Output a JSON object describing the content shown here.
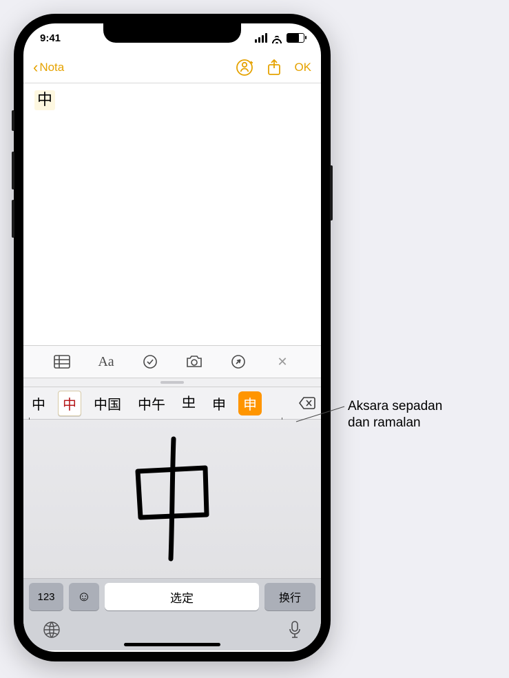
{
  "status": {
    "time": "9:41"
  },
  "nav": {
    "back_label": "Nota",
    "ok_label": "OK"
  },
  "note": {
    "text": "中"
  },
  "candidates": {
    "items": [
      "中",
      "中",
      "中国",
      "中午",
      "𠀐",
      "申",
      "申"
    ],
    "tile_index": 1,
    "highlight_index": 6
  },
  "keyboard": {
    "num_label": "123",
    "space_label": "选定",
    "return_label": "换行"
  },
  "callout": {
    "line1": "Aksara sepadan",
    "line2": "dan ramalan"
  },
  "icons": {
    "collaborate": "collaborate-icon",
    "share": "share-icon",
    "table": "table-icon",
    "text_format": "text-format-icon",
    "checklist": "checklist-icon",
    "camera": "camera-icon",
    "markup": "markup-icon",
    "close": "close-icon",
    "backspace": "backspace-icon",
    "emoji": "emoji-icon",
    "globe": "globe-icon",
    "mic": "mic-icon"
  }
}
